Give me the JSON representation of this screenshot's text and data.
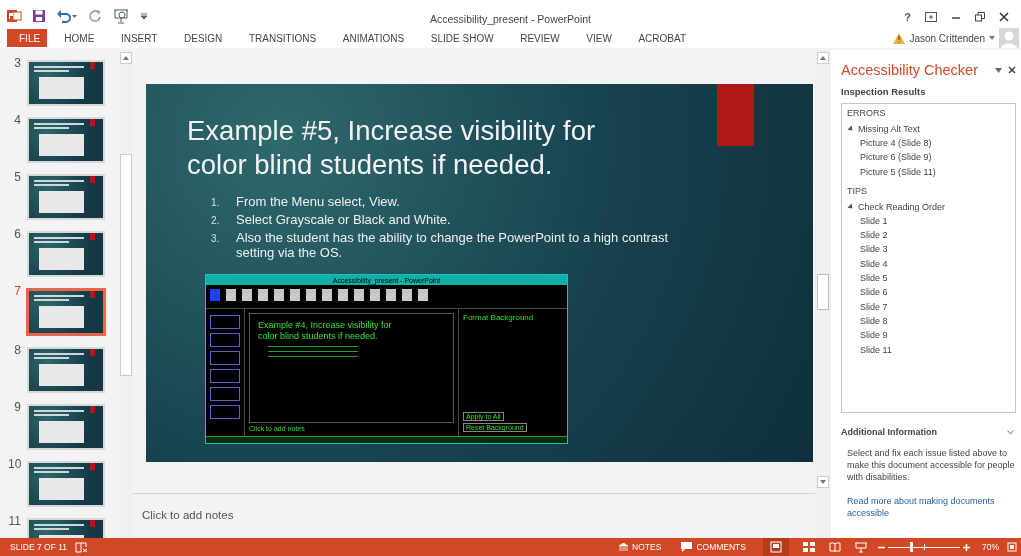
{
  "app": {
    "title": "Accessibility_present - PowerPoint",
    "help": "?",
    "user": "Jason Crittenden"
  },
  "ribbon_tabs": [
    {
      "label": "FILE",
      "kind": "file"
    },
    {
      "label": "HOME",
      "kind": "tab"
    },
    {
      "label": "INSERT",
      "kind": "tab"
    },
    {
      "label": "DESIGN",
      "kind": "tab"
    },
    {
      "label": "TRANSITIONS",
      "kind": "tab"
    },
    {
      "label": "ANIMATIONS",
      "kind": "tab"
    },
    {
      "label": "SLIDE SHOW",
      "kind": "tab"
    },
    {
      "label": "REVIEW",
      "kind": "tab"
    },
    {
      "label": "VIEW",
      "kind": "tab"
    },
    {
      "label": "ACROBAT",
      "kind": "tab"
    }
  ],
  "slides": [
    {
      "number": "3",
      "selected": false
    },
    {
      "number": "4",
      "selected": false
    },
    {
      "number": "5",
      "selected": false
    },
    {
      "number": "6",
      "selected": false
    },
    {
      "number": "7",
      "selected": true
    },
    {
      "number": "8",
      "selected": false
    },
    {
      "number": "9",
      "selected": false
    },
    {
      "number": "10",
      "selected": false
    },
    {
      "number": "11",
      "selected": false
    }
  ],
  "slide": {
    "title": "Example #5, Increase visibility for color blind students if needed.",
    "list": [
      {
        "marker": "1.",
        "text": "From the Menu select, View."
      },
      {
        "marker": "2.",
        "text": "Select Grayscale or Black and White."
      },
      {
        "marker": "3.",
        "text": "Also the student has the ability to change the PowerPoint to a high contrast setting via the OS."
      }
    ],
    "screenshot": {
      "window_title": "Accessibility_present - PowerPoint",
      "slide_title": "Example #4, Increase visibility for color blind students if needed.",
      "pane_title": "Format Background",
      "notes_placeholder": "Click to add notes",
      "buttons": [
        "Apply to All",
        "Reset Background"
      ]
    }
  },
  "notes": {
    "placeholder": "Click to add notes"
  },
  "checker": {
    "title": "Accessibility Checker",
    "subtitle": "Inspection Results",
    "groups": [
      {
        "heading": "ERRORS",
        "items": [
          {
            "label": "Missing Alt Text",
            "expanded": true,
            "children": [
              {
                "label": "Picture 4  (Slide 8)"
              },
              {
                "label": "Picture 6  (Slide 9)"
              },
              {
                "label": "Picture 5  (Slide 11)"
              }
            ]
          }
        ]
      },
      {
        "heading": "TIPS",
        "items": [
          {
            "label": "Check Reading Order",
            "expanded": true,
            "children": [
              {
                "label": "Slide 1"
              },
              {
                "label": "Slide 2"
              },
              {
                "label": "Slide 3"
              },
              {
                "label": "Slide 4"
              },
              {
                "label": "Slide 5"
              },
              {
                "label": "Slide 6"
              },
              {
                "label": "Slide 7"
              },
              {
                "label": "Slide 8"
              },
              {
                "label": "Slide 9"
              },
              {
                "label": "Slide 11"
              }
            ]
          }
        ]
      }
    ],
    "info": {
      "heading": "Additional Information",
      "text": "Select and fix each issue listed above to make this document accessible for people with disabilities.",
      "link": "Read more about making documents accessible"
    }
  },
  "status": {
    "slide": "SLIDE 7 OF 11",
    "notes": "NOTES",
    "comments": "COMMENTS",
    "zoom": "70%",
    "zoom_slider": {
      "level": 0.32
    }
  }
}
